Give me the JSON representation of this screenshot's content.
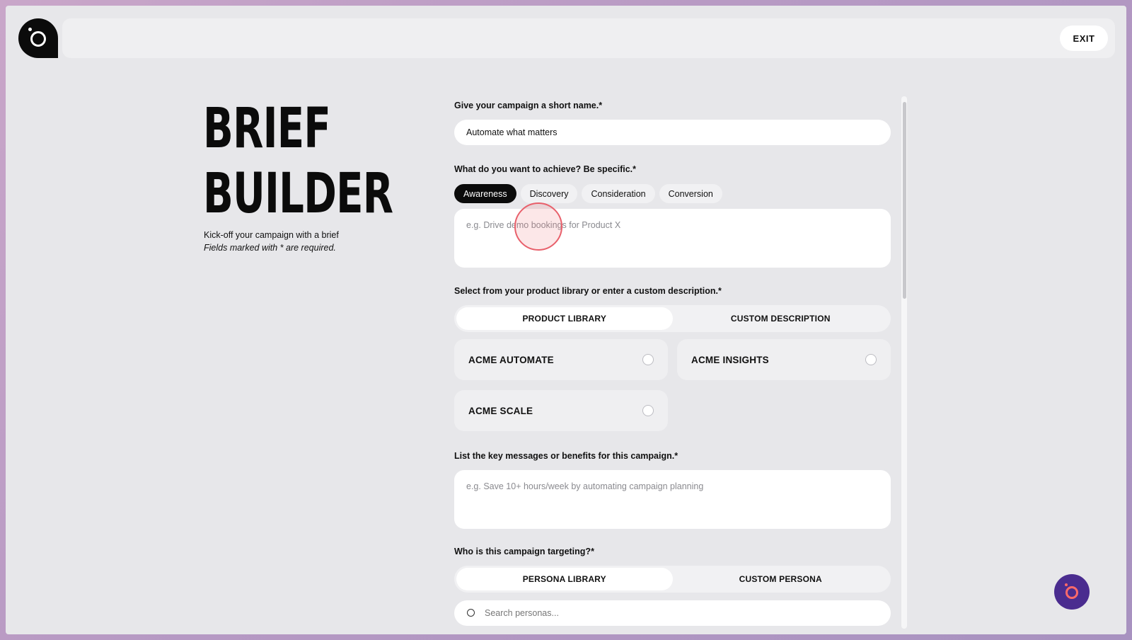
{
  "header": {
    "exit_label": "EXIT"
  },
  "hero": {
    "title_line1": "BRIEF",
    "title_line2": "BUILDER",
    "subtitle": "Kick-off your campaign with a brief",
    "required_note": "Fields marked with * are required."
  },
  "form": {
    "name": {
      "label": "Give your campaign a short name.*",
      "value": "Automate what matters"
    },
    "goal": {
      "label": "What do you want to achieve? Be specific.*",
      "options": [
        "Awareness",
        "Discovery",
        "Consideration",
        "Conversion"
      ],
      "selected": "Awareness",
      "placeholder": "e.g. Drive demo bookings for Product X"
    },
    "product": {
      "label": "Select from your product library or enter a custom description.*",
      "tabs": [
        "PRODUCT LIBRARY",
        "CUSTOM DESCRIPTION"
      ],
      "active_tab": "PRODUCT LIBRARY",
      "items": [
        "ACME AUTOMATE",
        "ACME INSIGHTS",
        "ACME SCALE"
      ]
    },
    "messages": {
      "label": "List the key messages or benefits for this campaign.*",
      "placeholder": "e.g. Save 10+ hours/week by automating campaign planning"
    },
    "targeting": {
      "label": "Who is this campaign targeting?*",
      "tabs": [
        "PERSONA LIBRARY",
        "CUSTOM PERSONA"
      ],
      "active_tab": "PERSONA LIBRARY",
      "search_placeholder": "Search personas..."
    }
  },
  "colors": {
    "accent": "#0b0b0b",
    "fab": "#4a2c8f",
    "fab_icon": "#ff6a6a",
    "click": "#e8606b"
  }
}
